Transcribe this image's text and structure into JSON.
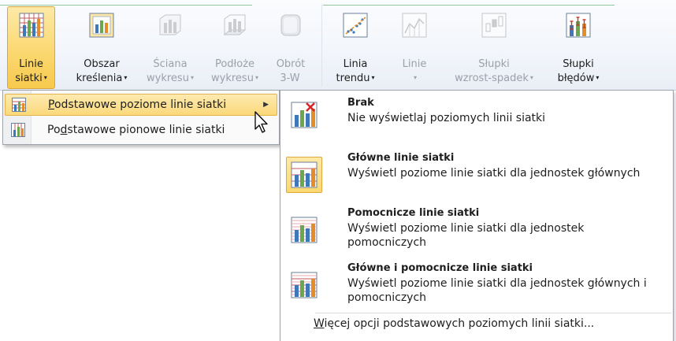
{
  "ribbon": {
    "buttons": [
      {
        "line1": "Linie",
        "line2": "siatki",
        "caret": "▾",
        "active": true,
        "disabled": false,
        "icon": "gridlines-icon"
      },
      {
        "line1": "Obszar",
        "line2": "kreślenia",
        "caret": "▾",
        "active": false,
        "disabled": false,
        "icon": "plot-area-icon"
      },
      {
        "line1": "Ściana",
        "line2": "wykresu",
        "caret": "▾",
        "active": false,
        "disabled": true,
        "icon": "chart-wall-icon"
      },
      {
        "line1": "Podłoże",
        "line2": "wykresu",
        "caret": "▾",
        "active": false,
        "disabled": true,
        "icon": "chart-floor-icon"
      },
      {
        "line1": "Obrót",
        "line2": "3-W",
        "caret": "",
        "active": false,
        "disabled": true,
        "icon": "rotation-3d-icon"
      },
      {
        "line1": "Linia",
        "line2": "trendu",
        "caret": "▾",
        "active": false,
        "disabled": false,
        "icon": "trendline-icon"
      },
      {
        "line1": "Linie",
        "line2": "",
        "caret": "▾",
        "active": false,
        "disabled": true,
        "icon": "lines-icon"
      },
      {
        "line1": "Słupki",
        "line2": "wzrost-spadek",
        "caret": "▾",
        "active": false,
        "disabled": true,
        "icon": "up-down-bars-icon"
      },
      {
        "line1": "Słupki",
        "line2": "błędów",
        "caret": "▾",
        "active": false,
        "disabled": false,
        "icon": "error-bars-icon"
      }
    ]
  },
  "submenu": {
    "items": [
      {
        "label": "Podstawowe poziome linie siatki",
        "mnemonic": "P",
        "rest": "odstawowe poziome linie siatki",
        "highlighted": true,
        "icon": "horizontal-gridlines-icon",
        "arrow": "▶"
      },
      {
        "label_pre": "Po",
        "mnemonic": "d",
        "rest": "stawowe pionowe linie siatki",
        "highlighted": false,
        "icon": "vertical-gridlines-icon"
      }
    ]
  },
  "flyout": {
    "items": [
      {
        "title": "Brak",
        "desc": "Nie wyświetlaj poziomych linii siatki",
        "selected": false,
        "icon": "no-gridlines-icon"
      },
      {
        "title": "Główne linie siatki",
        "desc": "Wyświetl poziome linie siatki dla jednostek głównych",
        "selected": true,
        "icon": "major-gridlines-icon"
      },
      {
        "title": "Pomocnicze linie siatki",
        "desc": "Wyświetl poziome linie siatki dla jednostek pomocniczych",
        "selected": false,
        "icon": "minor-gridlines-icon"
      },
      {
        "title": "Główne i pomocnicze linie siatki",
        "desc": "Wyświetl poziome linie siatki dla jednostek głównych i pomocniczych",
        "selected": false,
        "icon": "major-minor-gridlines-icon"
      }
    ],
    "more": {
      "mnemonic": "W",
      "rest": "ięcej opcji podstawowych poziomych linii siatki..."
    }
  },
  "colors": {
    "accent": "#fbd871",
    "accent_border": "#e1a73a",
    "group_line": "#8ec89a",
    "disabled_text": "#9aa1ab"
  }
}
